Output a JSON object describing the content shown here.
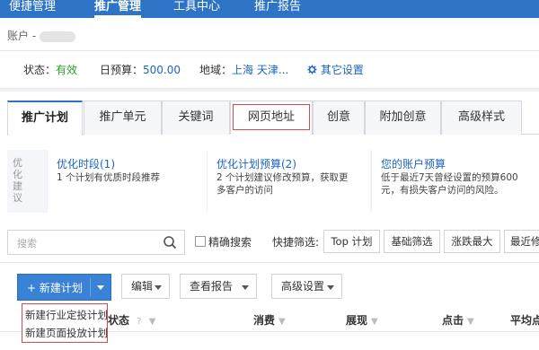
{
  "topnav": {
    "items": [
      {
        "label": "便捷管理"
      },
      {
        "label": "推广管理",
        "active": true
      },
      {
        "label": "工具中心"
      },
      {
        "label": "推广报告"
      }
    ],
    "bg_color": "#2d73c6"
  },
  "account": {
    "label": "账户 -"
  },
  "status": {
    "status_label": "状态：",
    "status_value": "有效",
    "budget_label": "日预算：",
    "budget_value": "500.00",
    "region_label": "地域：",
    "region_value": "上海 天津...",
    "settings_label": "其它设置",
    "settings_icon": "gear-icon"
  },
  "tabs": [
    {
      "label": "推广计划",
      "active": true
    },
    {
      "label": "推广单元"
    },
    {
      "label": "关键词"
    },
    {
      "label": "网页地址",
      "highlighted": true
    },
    {
      "label": "创意"
    },
    {
      "label": "附加创意"
    },
    {
      "label": "高级样式"
    }
  ],
  "suggest": {
    "vertical_label": "优化建议",
    "cards": [
      {
        "title": "优化时段(1)",
        "desc": "1 个计划有优质时段推荐"
      },
      {
        "title": "优化计划预算(2)",
        "desc": "2 个计划建议修改预算，获取更多客户的访问"
      },
      {
        "title": "您的账户预算",
        "desc": "低于最近7天曾经设置的预算600元，有损失客户访问的风险。"
      }
    ]
  },
  "search": {
    "placeholder": "搜索",
    "exact_label": "精确搜索",
    "quick_label": "快捷筛选:",
    "quick_buttons": [
      {
        "label": "Top 计划"
      },
      {
        "label": "基础筛选"
      },
      {
        "label": "涨跌最大"
      },
      {
        "label": "最近修"
      }
    ]
  },
  "toolbar": {
    "new_plan_label": "+  新建计划",
    "edit_label": "编辑",
    "report_label": "查看报告",
    "advanced_label": "高级设置"
  },
  "table": {
    "columns": [
      {
        "label": "状态"
      },
      {
        "label": "消费"
      },
      {
        "label": "展现"
      },
      {
        "label": "点击"
      },
      {
        "label": "平均点"
      }
    ]
  },
  "dropdown": {
    "options": [
      {
        "label": "新建行业定投计划"
      },
      {
        "label": "新建页面投放计划"
      }
    ]
  },
  "colors": {
    "accent": "#2d73c6",
    "status_green": "#2aa02a",
    "link_blue": "#1b64c0",
    "highlight_red": "#e04848"
  }
}
